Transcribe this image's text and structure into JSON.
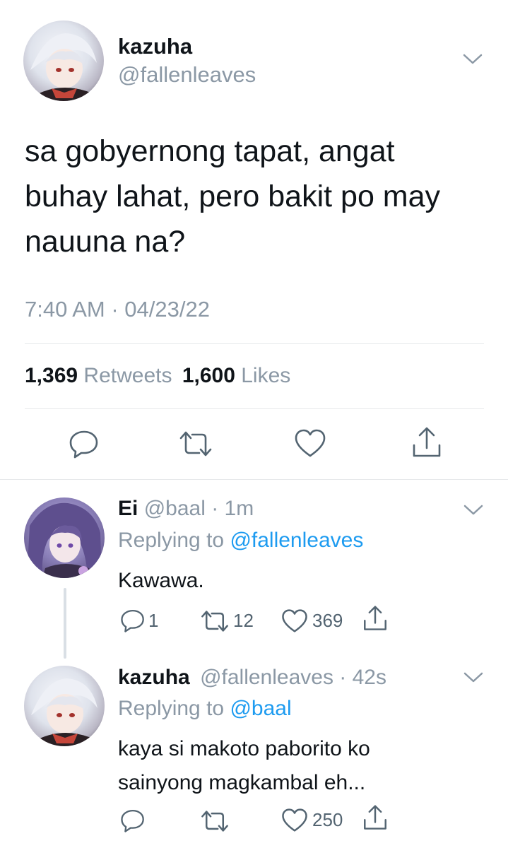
{
  "main_tweet": {
    "name": "kazuha",
    "handle": "@fallenleaves",
    "text_lines": [
      "sa gobyernong tapat, angat",
      "buhay lahat, pero bakit po may",
      "nauuna na?"
    ],
    "timestamp": "7:40 AM · 04/23/22",
    "retweets_count": "1,369",
    "retweets_label": "Retweets",
    "likes_count": "1,600",
    "likes_label": "Likes"
  },
  "reply1": {
    "name": "Ei",
    "handle_time": "@baal · 1m",
    "replying_prefix": "Replying to",
    "replying_to": "@fallenleaves",
    "text": "Kawawa.",
    "reply_count": "1",
    "retweet_count": "12",
    "like_count": "369"
  },
  "reply2": {
    "name": "kazuha",
    "handle_time": "@fallenleaves · 42s",
    "replying_prefix": "Replying to",
    "replying_to": "@baal",
    "text_lines": [
      "kaya si makoto paborito ko",
      "sainyong magkambal eh..."
    ],
    "like_count": "250"
  },
  "icons": {
    "reply": "reply-icon",
    "retweet": "retweet-icon",
    "like": "heart-icon",
    "share": "share-icon",
    "more": "chevron-down-icon"
  },
  "colors": {
    "link": "#1d9bf0",
    "muted": "#8b98a5",
    "text": "#0f1419"
  }
}
